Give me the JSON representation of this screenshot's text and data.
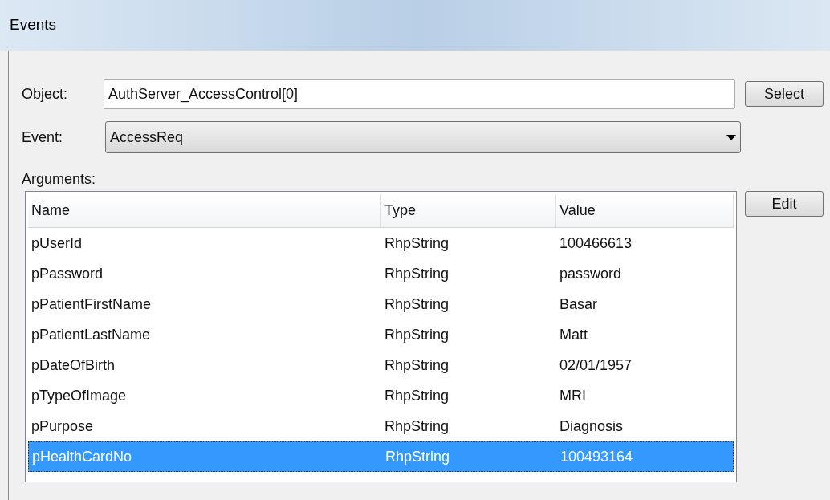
{
  "window": {
    "title": "Events"
  },
  "object": {
    "label": "Object:",
    "value": "AuthServer_AccessControl[0]",
    "button": "Select"
  },
  "event": {
    "label": "Event:",
    "value": "AccessReq"
  },
  "arguments": {
    "label": "Arguments:",
    "button": "Edit",
    "columns": [
      "Name",
      "Type",
      "Value"
    ],
    "rows": [
      {
        "name": "pUserId",
        "type": "RhpString",
        "value": "100466613",
        "selected": false
      },
      {
        "name": "pPassword",
        "type": "RhpString",
        "value": "password",
        "selected": false
      },
      {
        "name": "pPatientFirstName",
        "type": "RhpString",
        "value": "Basar",
        "selected": false
      },
      {
        "name": "pPatientLastName",
        "type": "RhpString",
        "value": "Matt",
        "selected": false
      },
      {
        "name": "pDateOfBirth",
        "type": "RhpString",
        "value": "02/01/1957",
        "selected": false
      },
      {
        "name": "pTypeOfImage",
        "type": "RhpString",
        "value": "MRI",
        "selected": false
      },
      {
        "name": "pPurpose",
        "type": "RhpString",
        "value": "Diagnosis",
        "selected": false
      },
      {
        "name": "pHealthCardNo",
        "type": "RhpString",
        "value": "100493164",
        "selected": true
      }
    ]
  }
}
